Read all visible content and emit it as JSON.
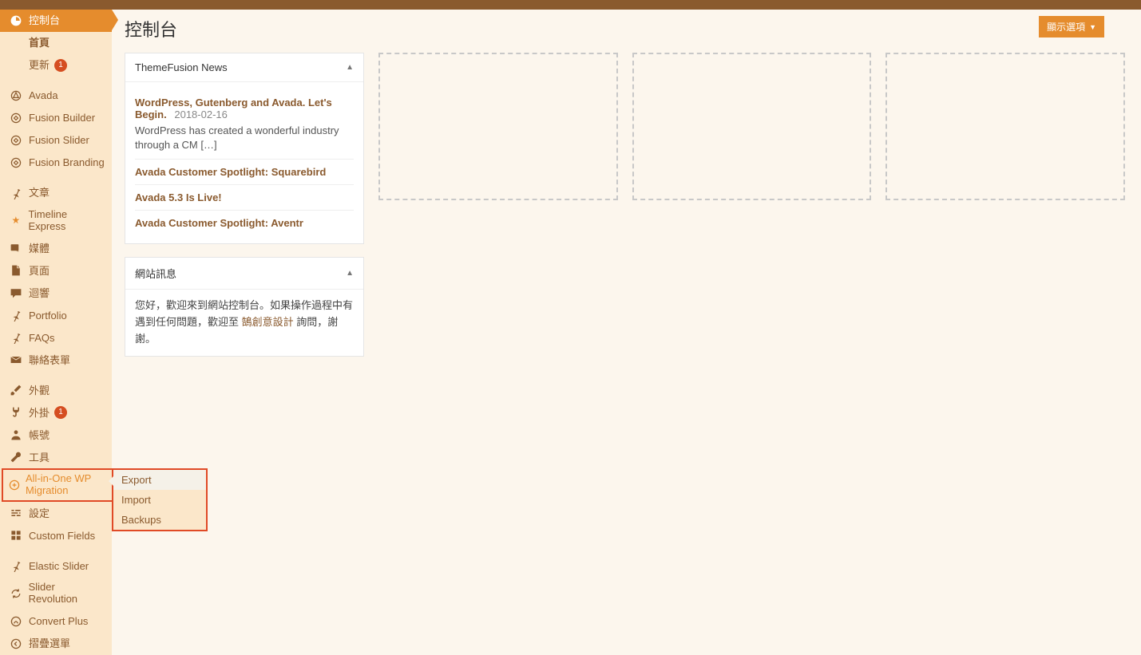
{
  "header": {
    "screen_options": "顯示選項"
  },
  "page": {
    "title": "控制台"
  },
  "sidebar": {
    "dashboard": "控制台",
    "home": "首頁",
    "updates": "更新",
    "updates_count": "1",
    "avada": "Avada",
    "fusion_builder": "Fusion Builder",
    "fusion_slider": "Fusion Slider",
    "fusion_branding": "Fusion Branding",
    "posts": "文章",
    "timeline_express": "Timeline Express",
    "media": "媒體",
    "pages": "頁面",
    "comments": "迴響",
    "portfolio": "Portfolio",
    "faqs": "FAQs",
    "contact_forms": "聯絡表單",
    "appearance": "外觀",
    "plugins": "外掛",
    "plugins_count": "1",
    "users": "帳號",
    "tools": "工具",
    "aiowpm": "All-in-One WP Migration",
    "settings": "設定",
    "custom_fields": "Custom Fields",
    "elastic_slider": "Elastic Slider",
    "slider_revolution": "Slider Revolution",
    "convert_plus": "Convert Plus",
    "collapse": "摺疊選單"
  },
  "flyout": {
    "export": "Export",
    "import": "Import",
    "backups": "Backups"
  },
  "news_panel": {
    "title": "ThemeFusion News",
    "items": [
      {
        "title": "WordPress, Gutenberg and Avada. Let's Begin.",
        "date": "2018-02-16",
        "excerpt": "WordPress has created a wonderful industry through a CM […]"
      },
      {
        "title": "Avada Customer Spotlight: Squarebird"
      },
      {
        "title": "Avada 5.3 Is Live!"
      },
      {
        "title": "Avada Customer Spotlight: Aventr"
      }
    ]
  },
  "site_info_panel": {
    "title": "網站訊息",
    "msg_1": "您好，歡迎來到網站控制台。如果操作過程中有遇到任何問題，歡迎至 ",
    "msg_link": "鵠創意設計",
    "msg_2": " 詢問，謝謝。"
  }
}
